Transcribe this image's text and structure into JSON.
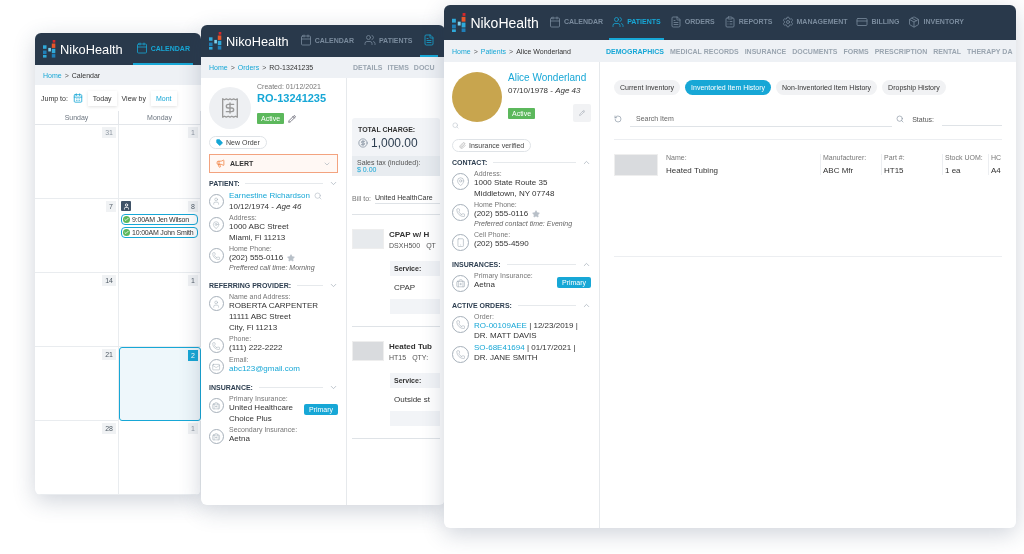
{
  "calendar_window": {
    "logo": "NikoHealth",
    "nav": [
      {
        "kind": "calendar",
        "label": "CALENDAR",
        "selected": true
      }
    ],
    "breadcrumb_separator": ">",
    "breadcrumb": [
      {
        "label": "Home",
        "link": true
      },
      {
        "label": "Calendar",
        "link": false
      }
    ],
    "jump_to_label": "Jump to:",
    "today_button": "Today",
    "view_by_label": "View by",
    "view_by_value": "Mont",
    "day_headers": [
      "Sunday",
      "Monday"
    ],
    "weeks": [
      [
        {
          "date": "31",
          "muted": true,
          "selected": false
        },
        {
          "date": "1",
          "muted": true,
          "selected": false
        }
      ],
      [
        {
          "date": "7",
          "muted": false,
          "selected": false
        },
        {
          "date": "8",
          "muted": false,
          "selected": false,
          "events": [
            {
              "time": "9:00AM",
              "name": "Jen Wilson",
              "confirmed": true
            },
            {
              "time": "10:00AM",
              "name": "John Smith",
              "confirmed": true
            }
          ]
        }
      ],
      [
        {
          "date": "14",
          "muted": false,
          "selected": false
        },
        {
          "date": "1",
          "muted": false,
          "selected": false
        }
      ],
      [
        {
          "date": "21",
          "muted": false,
          "selected": false
        },
        {
          "date": "2",
          "muted": false,
          "selected": true
        }
      ],
      [
        {
          "date": "28",
          "muted": false,
          "selected": false
        },
        {
          "date": "1",
          "muted": true,
          "selected": false
        }
      ]
    ]
  },
  "order_window": {
    "logo": "NikoHealth",
    "nav": [
      {
        "kind": "calendar",
        "label": "CALENDAR",
        "selected": false
      },
      {
        "kind": "patients",
        "label": "PATIENTS",
        "selected": false
      },
      {
        "kind": "orders",
        "selected": true
      }
    ],
    "breadcrumb_separator": ">",
    "breadcrumb": [
      {
        "label": "Home",
        "link": true
      },
      {
        "label": "Orders",
        "link": true
      },
      {
        "label": "RO-13241235",
        "link": false
      }
    ],
    "tabs": [
      {
        "label": "DETAILS",
        "selected": false
      },
      {
        "label": "ITEMS",
        "selected": false
      },
      {
        "label": "DOCU",
        "selected": false
      }
    ],
    "order": {
      "created": "Created: 01/12/2021",
      "number": "RO-13241235",
      "status": "Active",
      "new_order": "New Order",
      "alert": "ALERT"
    },
    "sections": [
      {
        "title": "PATIENT:",
        "chevron_up": false,
        "entries": [
          {
            "kind": "person",
            "lookup": true,
            "lines": [
              {
                "kind": "link",
                "text": "Earnestine Richardson"
              },
              {
                "kind": "text",
                "text": "10/12/1974 - *Age 46*"
              }
            ]
          },
          {
            "kind": "pin",
            "label": "Address:",
            "lines": [
              {
                "kind": "text",
                "text": "1000 ABC Street"
              },
              {
                "kind": "text",
                "text": "Miami, Fl 11213"
              }
            ]
          },
          {
            "kind": "phone",
            "label": "Home Phone:",
            "starred": true,
            "lines": [
              {
                "kind": "text",
                "text": "(202) 555-0116"
              },
              {
                "kind": "note",
                "text": "Preffered call time: Morning"
              }
            ]
          }
        ]
      },
      {
        "title": "REFERRING PROVIDER:",
        "chevron_up": false,
        "entries": [
          {
            "kind": "person",
            "label": "Name and Address:",
            "lines": [
              {
                "kind": "text",
                "text": "ROBERTA CARPENTER"
              },
              {
                "kind": "text",
                "text": "11111 ABC Street"
              },
              {
                "kind": "text",
                "text": "City, Fl 11213"
              }
            ]
          },
          {
            "kind": "phone",
            "label": "Phone:",
            "lines": [
              {
                "kind": "text",
                "text": "(111) 222-2222"
              }
            ]
          },
          {
            "kind": "mail",
            "label": "Email:",
            "lines": [
              {
                "kind": "link",
                "text": "abc123@gmail.com"
              }
            ]
          }
        ]
      },
      {
        "title": "INSURANCE:",
        "chevron_up": false,
        "entries": [
          {
            "kind": "medical",
            "label": "Primary Insurance:",
            "badge": "Primary",
            "lines": [
              {
                "kind": "text",
                "text": "United Healthcare"
              },
              {
                "kind": "text",
                "text": "Choice Plus"
              }
            ]
          },
          {
            "kind": "medical",
            "label": "Secondary Insurance:",
            "lines": [
              {
                "kind": "text",
                "text": "Aetna"
              }
            ]
          }
        ]
      }
    ],
    "charges": {
      "title": "TOTAL CHARGE:",
      "amount": "1,000.00",
      "tax_label": "Sales tax (included):",
      "tax_value": "$ 0.00"
    },
    "bill_to": {
      "label": "Bill to:",
      "value": "United HealthCare"
    },
    "items": [
      {
        "name": "CPAP w/ H",
        "code": "DSXH500",
        "qty": "QT",
        "service_label": "Service:",
        "service": "CPAP"
      },
      {
        "name": "Heated Tub",
        "code": "HT15",
        "qty": "QTY:",
        "service_label": "Service:",
        "service": "Outside st"
      }
    ]
  },
  "patient_window": {
    "logo": "NikoHealth",
    "nav": [
      {
        "kind": "calendar",
        "label": "CALENDAR",
        "selected": false
      },
      {
        "kind": "patients",
        "label": "PATIENTS",
        "selected": true
      },
      {
        "kind": "orders",
        "label": "ORDERS",
        "selected": false
      },
      {
        "kind": "reports",
        "label": "REPORTS",
        "selected": false
      },
      {
        "kind": "management",
        "label": "MANAGEMENT",
        "selected": false
      },
      {
        "kind": "billing",
        "label": "BILLING",
        "selected": false
      },
      {
        "kind": "inventory",
        "label": "INVENTORY",
        "selected": false
      }
    ],
    "breadcrumb_separator": ">",
    "breadcrumb": [
      {
        "label": "Home",
        "link": true
      },
      {
        "label": "Patients",
        "link": true
      },
      {
        "label": "Alice Wonderland",
        "link": false
      }
    ],
    "tabs": [
      {
        "label": "DEMOGRAPHICS",
        "selected": true
      },
      {
        "label": "MEDICAL RECORDS",
        "selected": false
      },
      {
        "label": "INSURANCE",
        "selected": false
      },
      {
        "label": "DOCUMENTS",
        "selected": false
      },
      {
        "label": "FORMS",
        "selected": false
      },
      {
        "label": "PRESCRIPTION",
        "selected": false
      },
      {
        "label": "RENTAL",
        "selected": false
      },
      {
        "label": "THERAPY DA",
        "selected": false
      }
    ],
    "patient": {
      "name": "Alice Wonderland",
      "dob": "07/10/1978 - *Age 43*",
      "status": "Active",
      "verified": "Insurance verified"
    },
    "sections": [
      {
        "title": "CONTACT:",
        "chevron_up": true,
        "entries": [
          {
            "kind": "pin",
            "label": "Address:",
            "lines": [
              {
                "kind": "text",
                "text": "1000 State Route 35"
              },
              {
                "kind": "text",
                "text": "Middletown, NY 07748"
              }
            ]
          },
          {
            "kind": "phone",
            "label": "Home Phone:",
            "starred": true,
            "lines": [
              {
                "kind": "text",
                "text": "(202) 555-0116"
              },
              {
                "kind": "note",
                "text": "Preferred contact time: Evening"
              }
            ]
          },
          {
            "kind": "mobile",
            "label": "Cell Phone:",
            "lines": [
              {
                "kind": "text",
                "text": "(202) 555-4590"
              }
            ]
          }
        ]
      },
      {
        "title": "INSURANCES:",
        "chevron_up": true,
        "entries": [
          {
            "kind": "medical",
            "label": "Primary Insurance:",
            "badge": "Primary",
            "lines": [
              {
                "kind": "text",
                "text": "Aetna"
              }
            ]
          }
        ]
      },
      {
        "title": "ACTIVE ORDERS:",
        "chevron_up": true,
        "entries": [
          {
            "kind": "phone",
            "label": "Order:",
            "lines": [
              {
                "kind": "order",
                "link": "RO-00109AEE",
                "text": "| 12/23/2019 | DR. MATT DAVIS"
              }
            ]
          },
          {
            "kind": "phone",
            "lines": [
              {
                "kind": "order",
                "link": "SO-68E41694",
                "text": "| 01/17/2021 | DR. JANE SMITH"
              }
            ]
          }
        ]
      }
    ],
    "history_tabs": [
      {
        "label": "Current Inventory",
        "selected": false
      },
      {
        "label": "Inventoried Item History",
        "selected": true
      },
      {
        "label": "Non-Inventoried Item History",
        "selected": false
      },
      {
        "label": "Dropship History",
        "selected": false
      }
    ],
    "search": {
      "placeholder": "Search Item"
    },
    "status_label": "Status:",
    "items": [
      {
        "fields": [
          {
            "label": "Name:",
            "value": "Heated Tubing"
          },
          {
            "label": "Manufacturer:",
            "value": "ABC Mfr"
          },
          {
            "label": "Part #:",
            "value": "HT15"
          },
          {
            "label": "Stock UOM:",
            "value": "1 ea"
          },
          {
            "label": "HC",
            "value": "A4"
          }
        ]
      }
    ]
  }
}
